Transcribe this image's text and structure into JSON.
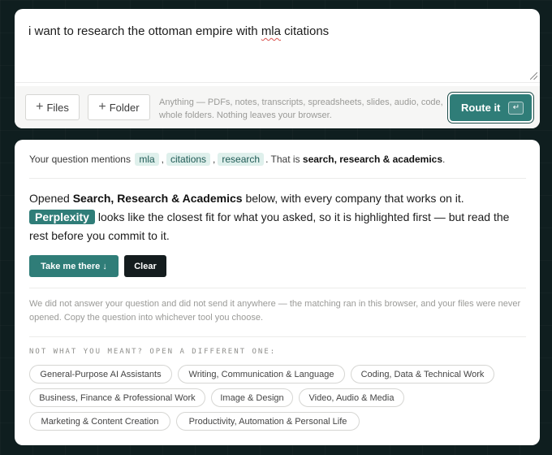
{
  "input": {
    "query_before_spell": "i want to research the ottoman empire with ",
    "query_misspelled_word": "mla",
    "query_after_spell": " citations",
    "files_label": "Files",
    "folder_label": "Folder",
    "hint": "Anything — PDFs, notes, transcripts, spreadsheets, slides, audio, code, whole folders. Nothing leaves your browser.",
    "route_label": "Route it",
    "route_key": "↵"
  },
  "result": {
    "mention_prefix": "Your question mentions",
    "tags": [
      "mla",
      "citations",
      "research"
    ],
    "mention_middle": ". That is",
    "category_bold": "search, research & academics",
    "mention_end": ".",
    "opened_prefix": "Opened",
    "opened_category": "Search, Research & Academics",
    "opened_suffix": "below, with every company that works on it.",
    "highlight_name": "Perplexity",
    "fit_text": "looks like the closest fit for what you asked, so it is highlighted first — but read the rest before you commit to it.",
    "take_label": "Take me there ↓",
    "clear_label": "Clear",
    "disclaimer": "We did not answer your question and did not send it anywhere — the matching ran in this browser, and your files were never opened. Copy the question into whichever tool you choose.",
    "alt_heading": "NOT WHAT YOU MEANT? OPEN A DIFFERENT ONE:",
    "categories": [
      "General-Purpose AI Assistants",
      "Writing, Communication & Language",
      "Coding, Data & Technical Work",
      "Business, Finance & Professional Work",
      "Image & Design",
      "Video, Audio & Media",
      "Marketing & Content Creation",
      "Productivity, Automation & Personal Life"
    ]
  },
  "colors": {
    "accent": "#2f7d78",
    "tag_bg": "#dff0ec",
    "dark_button": "#141c1e",
    "page_bg": "#0f1e1f"
  },
  "icons": {
    "add": "plus-icon",
    "route": "enter-key-icon",
    "resize": "resize-grip-icon"
  }
}
